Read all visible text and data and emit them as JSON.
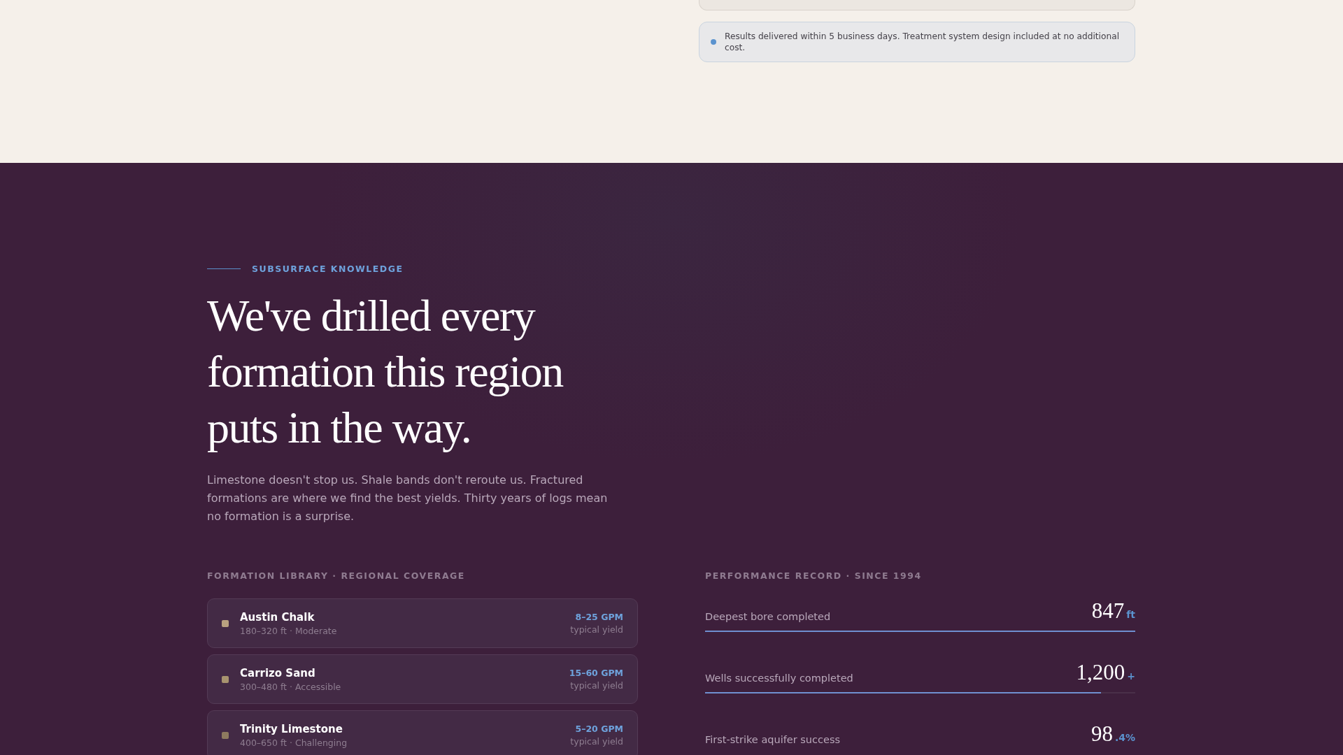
{
  "note": {
    "text": "Results delivered within 5 business days. Treatment system design included at no additional cost."
  },
  "section": {
    "eyebrow": "SUBSURFACE KNOWLEDGE",
    "headline": "We've drilled every formation this region puts in the way.",
    "intro": "Limestone doesn't stop us. Shale bands don't reroute us. Fractured formations are where we find the best yields. Thirty years of logs mean no formation is a surprise."
  },
  "formations": {
    "label": "FORMATION LIBRARY · REGIONAL COVERAGE",
    "items": [
      {
        "name": "Austin Chalk",
        "detail": "180–320 ft · Moderate",
        "yield": "8–25 GPM",
        "yield_label": "typical yield",
        "color": "#b9a180"
      },
      {
        "name": "Carrizo Sand",
        "detail": "300–480 ft · Accessible",
        "yield": "15–60 GPM",
        "yield_label": "typical yield",
        "color": "#a8936f"
      },
      {
        "name": "Trinity Limestone",
        "detail": "400–650 ft · Challenging",
        "yield": "5–20 GPM",
        "yield_label": "typical yield",
        "color": "#8e7a5f"
      }
    ]
  },
  "performance": {
    "label": "PERFORMANCE RECORD · SINCE 1994",
    "metrics": [
      {
        "label": "Deepest bore completed",
        "value": "847",
        "unit": "ft",
        "level": 1.0
      },
      {
        "label": "Wells successfully completed",
        "value": "1,200",
        "unit": "+",
        "level": 0.92
      },
      {
        "label": "First-strike aquifer success",
        "value": "98",
        "unit": ".4%"
      }
    ]
  }
}
